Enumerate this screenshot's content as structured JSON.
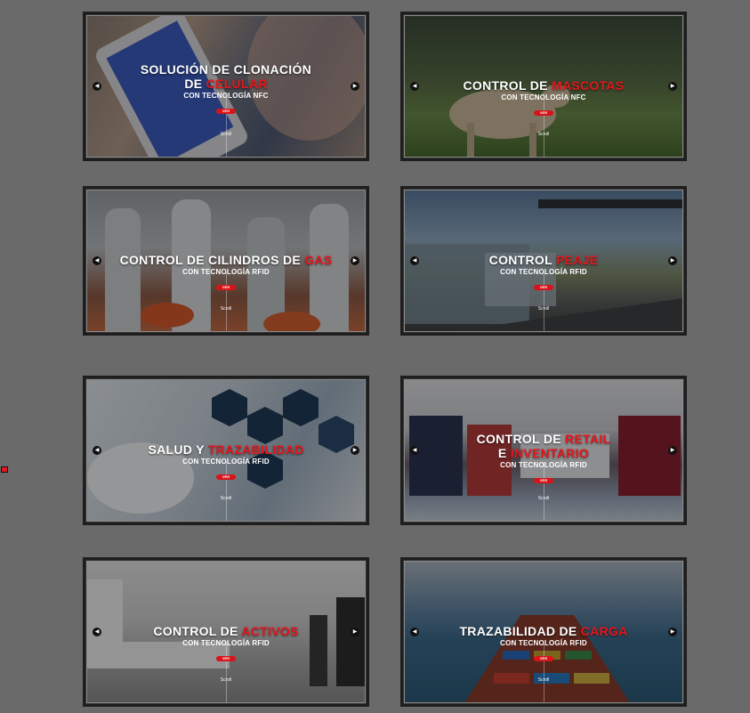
{
  "cards": [
    {
      "title_a": "SOLUCIÓN DE CLONACIÓN",
      "title_b": "DE ",
      "title_hl": "CELULAR",
      "subtitle": "CON TECNOLOGÍA NFC",
      "button": "VER",
      "scroll": "Scroll"
    },
    {
      "title_a": "CONTROL DE ",
      "title_hl": "MASCOTAS",
      "subtitle": "CON TECNOLOGÍA NFC",
      "button": "VER",
      "scroll": "Scroll"
    },
    {
      "title_a": "CONTROL DE CILINDROS DE ",
      "title_hl": "GAS",
      "subtitle": "CON TECNOLOGÍA RFID",
      "button": "VER",
      "scroll": "Scroll"
    },
    {
      "title_a": "CONTROL ",
      "title_hl": "PEAJE",
      "subtitle": "CON TECNOLOGÍA RFID",
      "button": "VER",
      "scroll": "Scroll"
    },
    {
      "title_a": "SALUD Y ",
      "title_hl": "TRAZABILIDAD",
      "subtitle": "CON TECNOLOGÍA RFID",
      "button": "VER",
      "scroll": "Scroll"
    },
    {
      "title_a": "CONTROL DE ",
      "title_hl": "RETAIL",
      "title_b": "E ",
      "title_hl2": "INVENTARIO",
      "subtitle": "CON TECNOLOGÍA RFID",
      "button": "VER",
      "scroll": "Scroll"
    },
    {
      "title_a": "CONTROL DE ",
      "title_hl": "ACTIVOS",
      "subtitle": "CON TECNOLOGÍA RFID",
      "button": "VER",
      "scroll": "Scroll"
    },
    {
      "title_a": "TRAZABILIDAD DE ",
      "title_hl": "CARGA",
      "subtitle": "CON TECNOLOGÍA RFID",
      "button": "VER",
      "scroll": "Scroll"
    }
  ],
  "colors": {
    "accent": "#e8161b",
    "background": "#6a6a6a"
  },
  "icons": {
    "prev": "chevron-left-icon",
    "next": "chevron-right-icon"
  }
}
